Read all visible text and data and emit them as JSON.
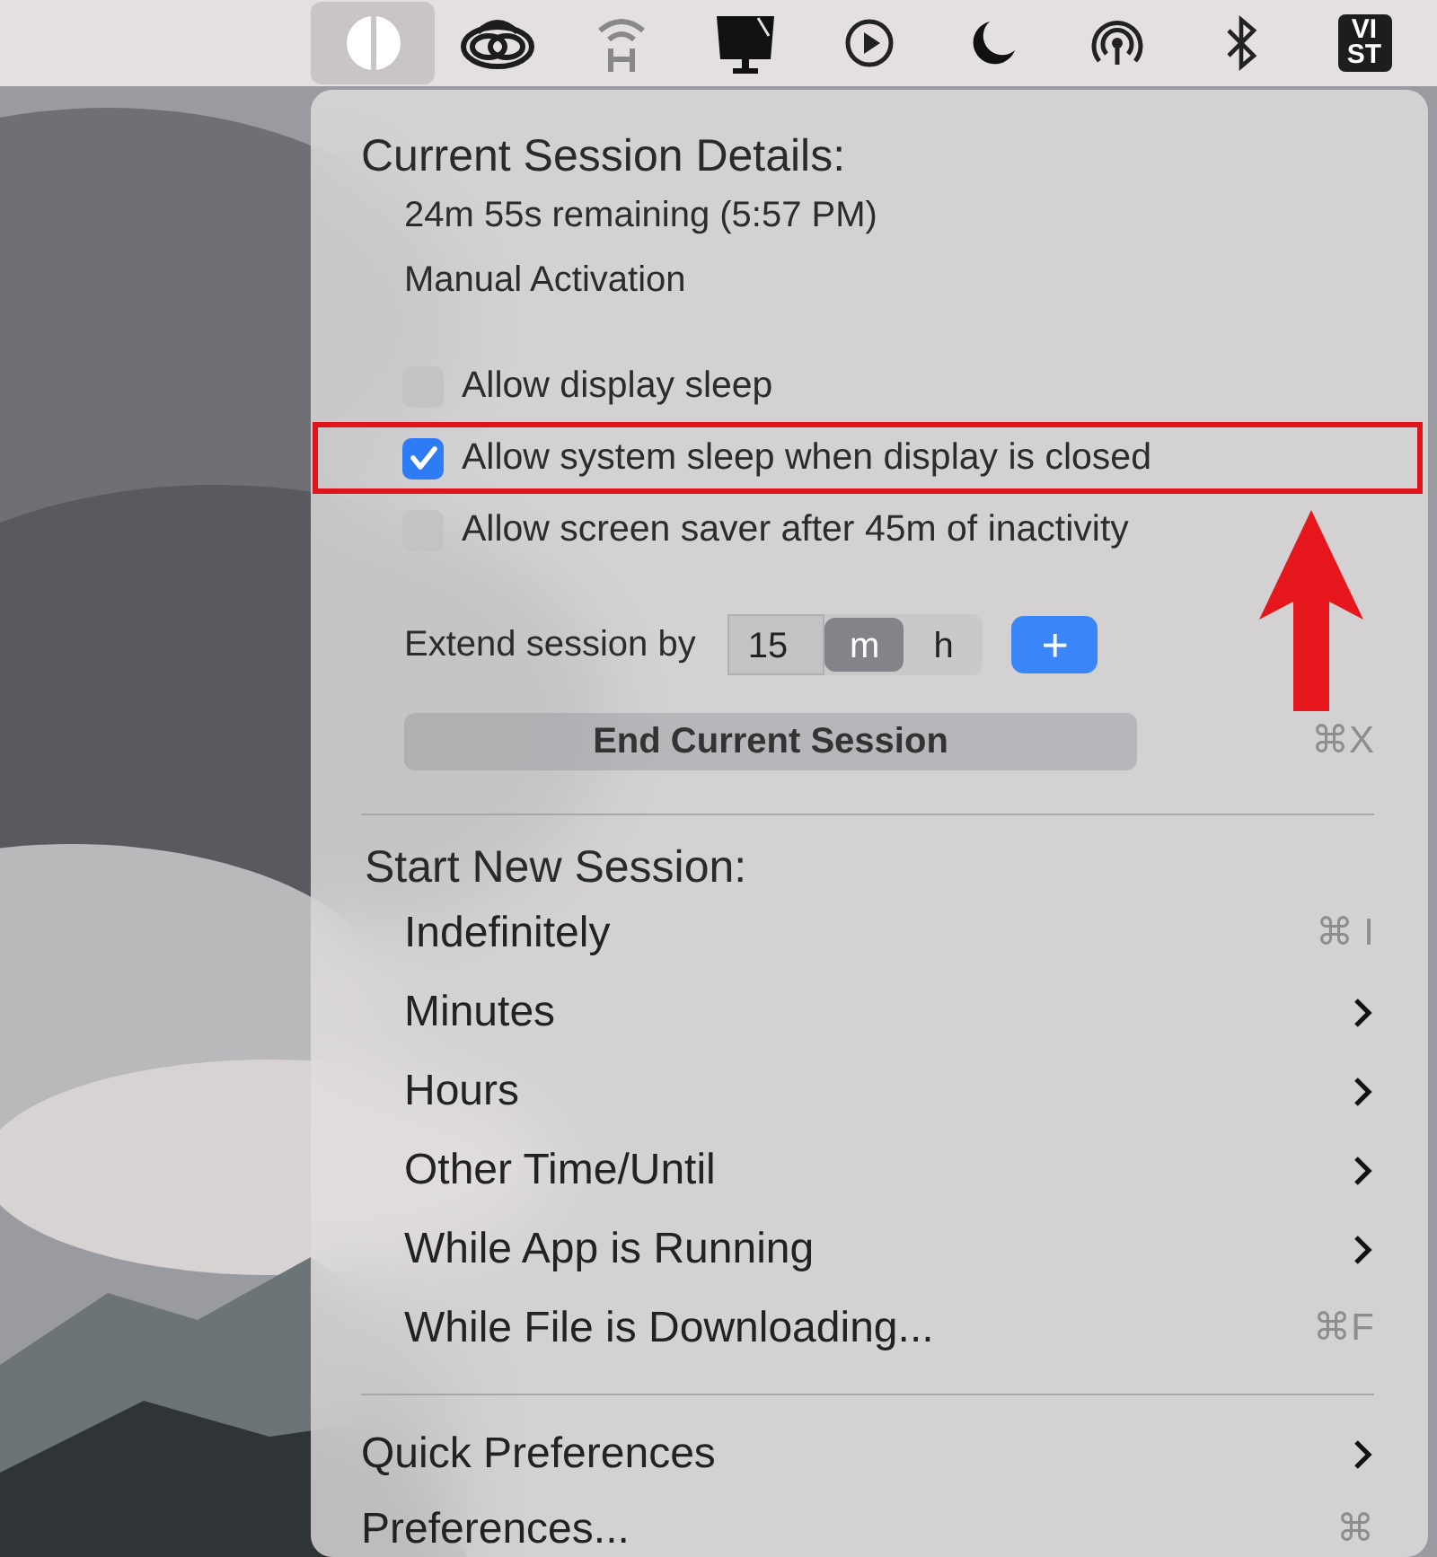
{
  "menubar": {
    "items": [
      {
        "kind": "amphetamine",
        "selected": true
      },
      {
        "kind": "loops",
        "selected": false
      },
      {
        "kind": "wifi",
        "selected": false
      },
      {
        "kind": "monitor",
        "selected": false
      },
      {
        "kind": "play",
        "selected": false
      },
      {
        "kind": "moon",
        "selected": false
      },
      {
        "kind": "broadcast",
        "selected": false
      },
      {
        "kind": "bluetooth",
        "selected": false
      },
      {
        "kind": "badge",
        "lines": [
          "VI",
          "ST"
        ],
        "selected": false
      }
    ]
  },
  "menu": {
    "session_heading": "Current Session Details:",
    "session_lines": [
      "24m 55s remaining (5:57 PM)",
      "Manual Activation"
    ],
    "options": [
      {
        "label": "Allow display sleep",
        "checked": false,
        "annotated": false
      },
      {
        "label": "Allow system sleep when display is closed",
        "checked": true,
        "annotated": true
      },
      {
        "label": "Allow screen saver after 45m of inactivity",
        "checked": false,
        "annotated": false
      }
    ],
    "extend": {
      "label": "Extend session by",
      "value": "15",
      "units": [
        {
          "label": "m",
          "selected": true
        },
        {
          "label": "h",
          "selected": false
        }
      ],
      "add_button": "+"
    },
    "end_button": {
      "label": "End Current Session",
      "shortcut": "⌘X"
    },
    "new_heading": "Start New Session:",
    "new_items": [
      {
        "label": "Indefinitely",
        "kind": "shortcut",
        "shortcut": "⌘ I"
      },
      {
        "label": "Minutes",
        "kind": "submenu"
      },
      {
        "label": "Hours",
        "kind": "submenu"
      },
      {
        "label": "Other Time/Until",
        "kind": "submenu"
      },
      {
        "label": "While App is Running",
        "kind": "submenu"
      },
      {
        "label": "While File is Downloading...",
        "kind": "shortcut",
        "shortcut": "⌘F"
      }
    ],
    "footer_items": [
      {
        "label": "Quick Preferences",
        "kind": "submenu"
      },
      {
        "label": "Preferences...",
        "kind": "shortcut",
        "shortcut": "⌘"
      }
    ]
  }
}
